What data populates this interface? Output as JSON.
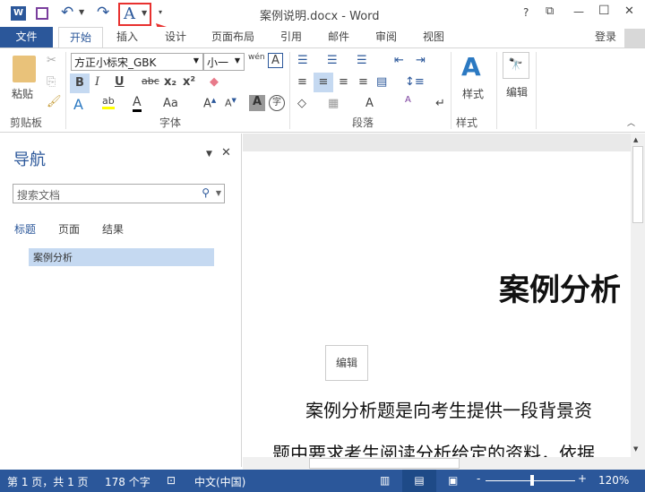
{
  "title": "案例说明.docx - Word",
  "qat": {
    "word_icon": "W",
    "save": "save-icon",
    "undo": "undo-icon",
    "redo": "redo-icon",
    "font_btn": "A"
  },
  "window": {
    "help": "?",
    "restore_ribbon": "⧉",
    "min": "—",
    "max": "☐",
    "close": "✕"
  },
  "tabs": [
    "文件",
    "开始",
    "插入",
    "设计",
    "页面布局",
    "引用",
    "邮件",
    "审阅",
    "视图"
  ],
  "login": "登录",
  "ribbon": {
    "paste": "粘贴",
    "clipboard": "剪贴板",
    "font_name": "方正小标宋_GBK",
    "font_size": "小一",
    "font_group": "字体",
    "para_group": "段落",
    "styles": "样式",
    "styles_group": "样式",
    "edit": "编辑",
    "bold": "B",
    "italic": "I",
    "underline": "U",
    "strike": "abc",
    "sub": "x₂",
    "sup": "x²",
    "wen": "wén",
    "aa": "Aa"
  },
  "nav": {
    "title": "导航",
    "search_placeholder": "搜索文档",
    "tabs": [
      "标题",
      "页面",
      "结果"
    ],
    "items": [
      "案例分析"
    ]
  },
  "doc": {
    "heading": "案例分析",
    "tooltip": "编辑",
    "p1": "案例分析题是向考生提供一段背景资",
    "p2": "题中要求考生阅读分析给定的资料，依据"
  },
  "status": {
    "page": "第 1 页，共 1 页",
    "words": "178 个字",
    "lang": "中文(中国)",
    "zoom": "120%"
  },
  "colors": {
    "accent": "#2b579a",
    "highlight": "#c5d9f1",
    "annotation": "#e8312f"
  }
}
